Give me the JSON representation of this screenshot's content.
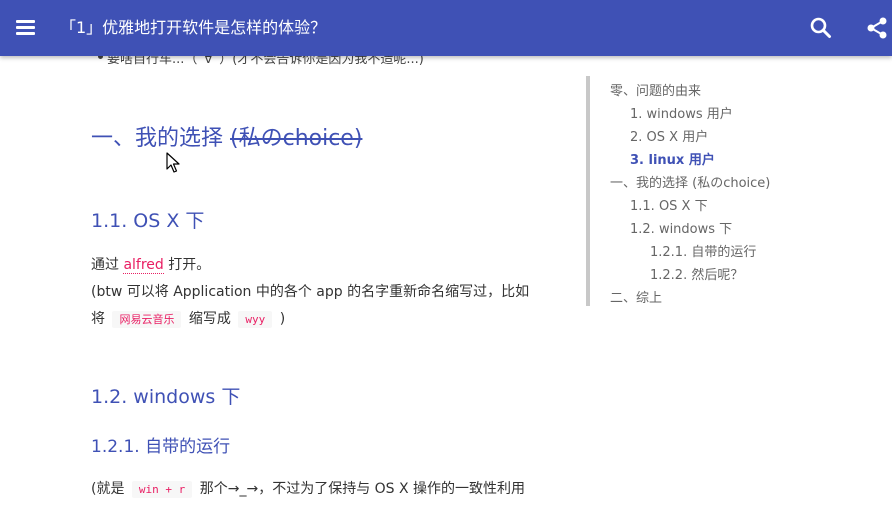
{
  "header": {
    "title": "「1」优雅地打开软件是怎样的体验？",
    "menu_icon": "menu-icon",
    "search_icon": "search-icon",
    "share_icon": "share-icon",
    "bar_color": "#3f51b5"
  },
  "article": {
    "partial_bullet_text": "要啥自行车...（´∀`）(才不会告诉你是因为我不造呢...)",
    "section1": {
      "title_main": "一、我的选择",
      "title_strike": "(私のchoice)"
    },
    "s11": {
      "title": "1.1. OS X 下",
      "p1_prefix": "通过",
      "p1_link": "alfred",
      "p1_suffix": "打开。",
      "p2_line1": "(btw 可以将 Application 中的各个 app 的名字重新命名缩写过，比如",
      "p2_line2_prefix": "将",
      "p2_code1": "网易云音乐",
      "p2_mid": "缩写成",
      "p2_code2": "wyy",
      "p2_end": ")"
    },
    "s12": {
      "title": "1.2. windows 下"
    },
    "s121": {
      "title": "1.2.1. 自带的运行",
      "p_prefix": "(就是",
      "p_code": "win + r",
      "p_suffix": "那个→_→，不过为了保持与 OS X 操作的一致性利用"
    }
  },
  "toc": {
    "items": [
      {
        "label": "零、问题的由来",
        "level": 0,
        "active": false
      },
      {
        "label": "1. windows 用户",
        "level": 1,
        "active": false
      },
      {
        "label": "2. OS X 用户",
        "level": 1,
        "active": false
      },
      {
        "label": "3. linux 用户",
        "level": 1,
        "active": true
      },
      {
        "label": "一、我的选择 (私のchoice)",
        "level": 0,
        "active": false
      },
      {
        "label": "1.1. OS X 下",
        "level": 1,
        "active": false
      },
      {
        "label": "1.2. windows 下",
        "level": 1,
        "active": false
      },
      {
        "label": "1.2.1. 自带的运行",
        "level": 2,
        "active": false
      },
      {
        "label": "1.2.2. 然后呢？",
        "level": 2,
        "active": false
      },
      {
        "label": "二、综上",
        "level": 0,
        "active": false
      }
    ]
  },
  "colors": {
    "accent": "#3f51b5",
    "code_pink": "#e91e63"
  }
}
